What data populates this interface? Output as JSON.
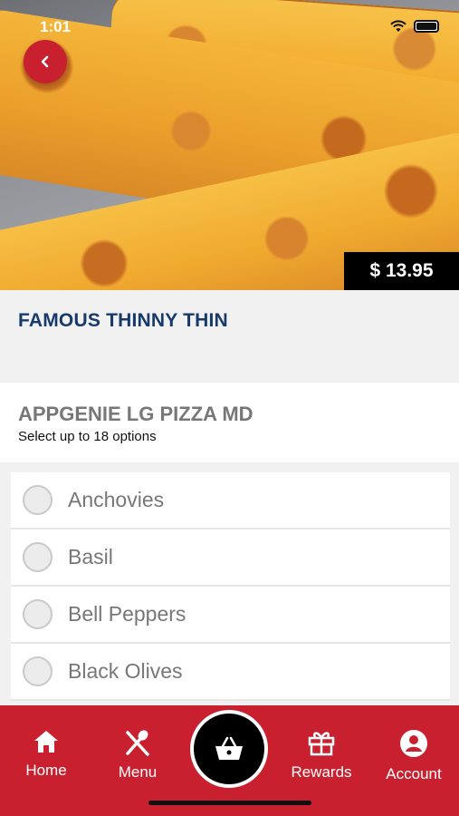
{
  "status_bar": {
    "time": "1:01"
  },
  "item": {
    "price": "$ 13.95",
    "title": "FAMOUS THINNY THIN"
  },
  "option_group": {
    "title": "APPGENIE LG PIZZA MD",
    "subtitle": "Select up to 18 options",
    "options": [
      {
        "label": "Anchovies",
        "selected": false
      },
      {
        "label": "Basil",
        "selected": false
      },
      {
        "label": "Bell Peppers",
        "selected": false
      },
      {
        "label": "Black Olives",
        "selected": false
      }
    ]
  },
  "nav": {
    "home": "Home",
    "menu": "Menu",
    "rewards": "Rewards",
    "account": "Account"
  },
  "colors": {
    "brand_red": "#c8202f",
    "title_blue": "#173a6b"
  },
  "icons": [
    "back-chevron-icon",
    "wifi-icon",
    "battery-icon",
    "home-icon",
    "utensils-icon",
    "basket-icon",
    "gift-icon",
    "user-icon"
  ]
}
